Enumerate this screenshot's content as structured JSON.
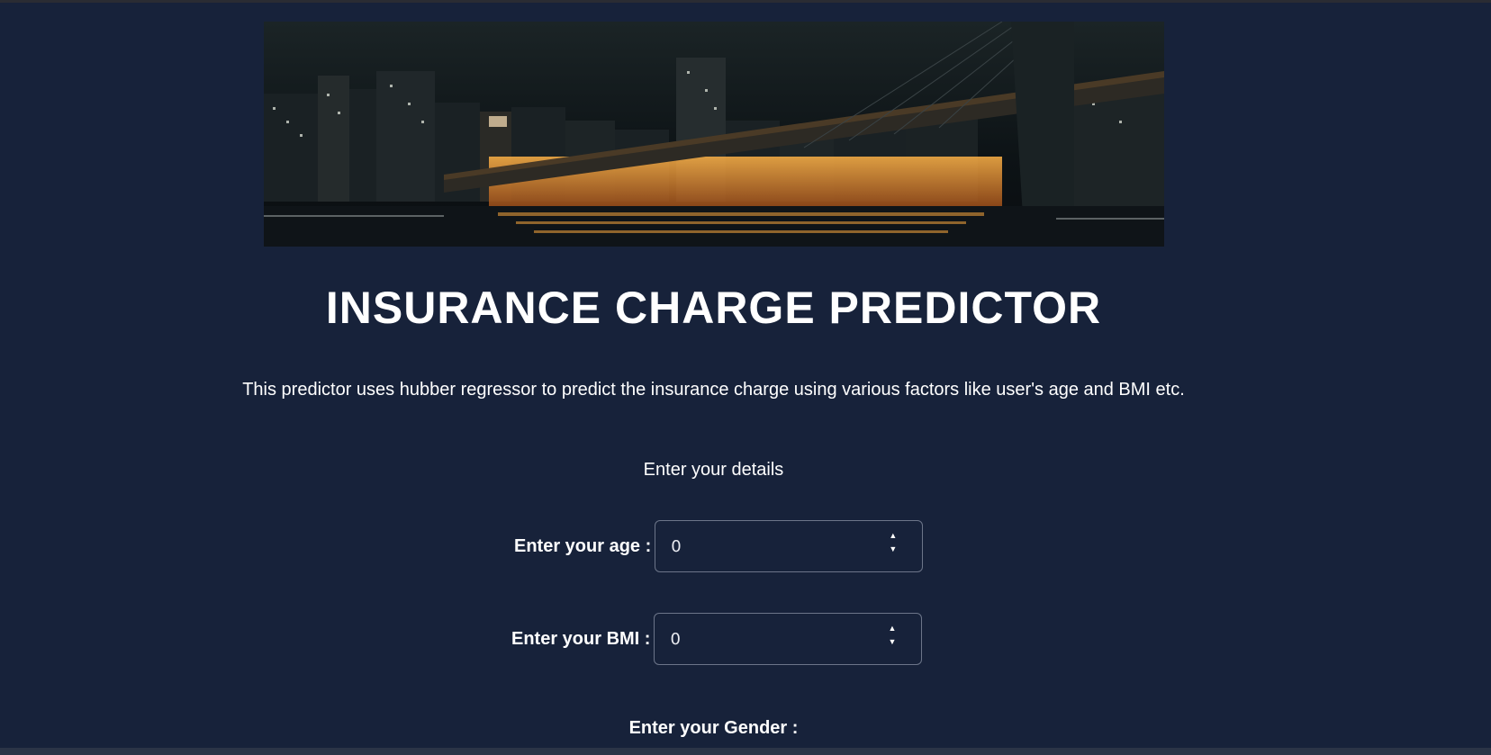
{
  "banner": {
    "alt": "night city skyline with illuminated bridge over river"
  },
  "title": "INSURANCE CHARGE PREDICTOR",
  "description": "This predictor uses hubber regressor to predict the insurance charge using various factors like user's age and BMI etc.",
  "form": {
    "heading": "Enter your details",
    "age_label": "Enter your age :",
    "age_value": "0",
    "bmi_label": "Enter your BMI :",
    "bmi_value": "0",
    "gender_label": "Enter your Gender :"
  },
  "icons": {
    "spin_up": "caret-up-icon",
    "spin_down": "caret-down-icon"
  },
  "colors": {
    "background": "#17223a",
    "text": "#ffffff",
    "input_border": "#6c7589"
  }
}
